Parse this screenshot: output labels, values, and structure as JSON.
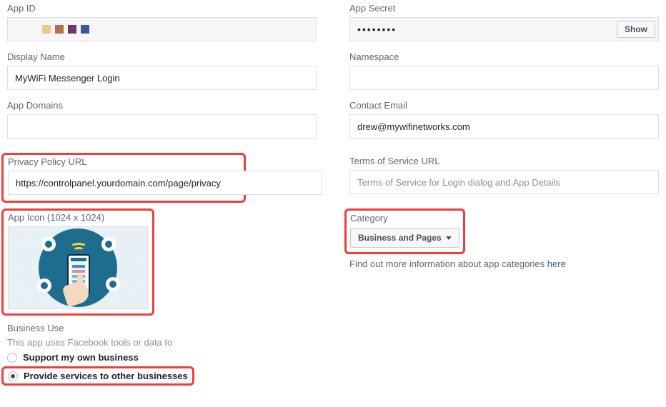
{
  "appId": {
    "label": "App ID"
  },
  "appSecret": {
    "label": "App Secret",
    "mask": "••••••••",
    "showLabel": "Show"
  },
  "displayName": {
    "label": "Display Name",
    "value": "MyWiFi Messenger Login"
  },
  "namespace": {
    "label": "Namespace",
    "value": ""
  },
  "appDomains": {
    "label": "App Domains",
    "value": ""
  },
  "contactEmail": {
    "label": "Contact Email",
    "value": "drew@mywifinetworks.com"
  },
  "privacy": {
    "label": "Privacy Policy URL",
    "value": "https://controlpanel.yourdomain.com/page/privacy"
  },
  "tos": {
    "label": "Terms of Service URL",
    "placeholder": "Terms of Service for Login dialog and App Details",
    "value": ""
  },
  "appIcon": {
    "label": "App Icon (1024 x 1024)"
  },
  "category": {
    "label": "Category",
    "selected": "Business and Pages",
    "infoPrefix": "Find out more information about app categories ",
    "infoLink": "here"
  },
  "businessUse": {
    "label": "Business Use",
    "sub": "This app uses Facebook tools or data to",
    "option1": "Support my own business",
    "option2": "Provide services to other businesses",
    "selected": "option2"
  }
}
